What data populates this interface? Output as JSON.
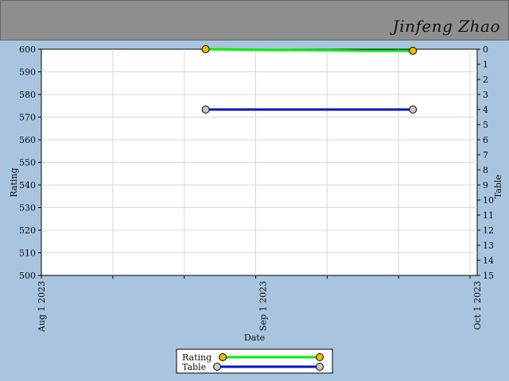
{
  "header": {
    "player_name": "Jinfeng Zhao"
  },
  "colors": {
    "page_background": "#a8c4de",
    "header_background": "#8e8e8e",
    "plot_background": "#ffffff",
    "grid": "#d8d8d8",
    "rating_line": "#00ee00",
    "rating_marker": "#f5b800",
    "table_line": "#0010c8",
    "table_marker": "#c8c8c8"
  },
  "chart_data": {
    "type": "line",
    "xlabel": "Date",
    "ylabel_left": "Rating",
    "ylabel_right": "Table",
    "x_ticks": [
      "Aug 1 2023",
      "Sep 1 2023",
      "Oct 1 2023"
    ],
    "x_range": [
      "2023-08-01",
      "2023-10-01"
    ],
    "y_left_range": [
      500,
      600
    ],
    "y_left_ticks": [
      500,
      510,
      520,
      530,
      540,
      550,
      560,
      570,
      580,
      590,
      600
    ],
    "y_right_range": [
      0,
      15
    ],
    "y_right_inverted": true,
    "y_right_ticks": [
      0,
      1,
      2,
      3,
      4,
      5,
      6,
      7,
      8,
      9,
      10,
      11,
      12,
      13,
      14,
      15
    ],
    "grid": true,
    "legend_position": "bottom-center",
    "series": [
      {
        "name": "Rating",
        "axis": "left",
        "points": [
          {
            "x": "2023-08-24",
            "y": 600
          },
          {
            "x": "2023-09-01",
            "y": 599.7
          },
          {
            "x": "2023-09-11",
            "y": 599.5
          },
          {
            "x": "2023-09-15",
            "y": 599.3
          },
          {
            "x": "2023-09-22",
            "y": 599.3
          }
        ],
        "markers": [
          {
            "x": "2023-08-24",
            "y": 600
          },
          {
            "x": "2023-09-22",
            "y": 599.3
          }
        ]
      },
      {
        "name": "Table",
        "axis": "right",
        "points": [
          {
            "x": "2023-08-24",
            "y": 4
          },
          {
            "x": "2023-09-22",
            "y": 4
          }
        ],
        "markers": [
          {
            "x": "2023-08-24",
            "y": 4
          },
          {
            "x": "2023-09-22",
            "y": 4
          }
        ]
      }
    ]
  }
}
